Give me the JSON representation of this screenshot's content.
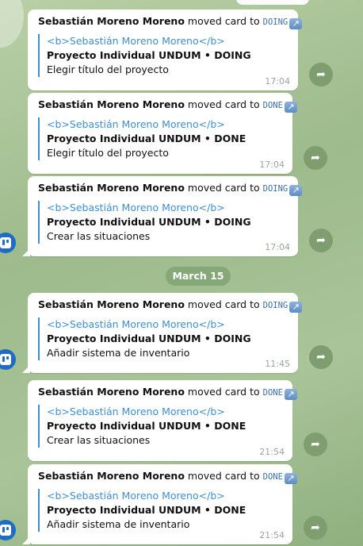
{
  "previous_time": "17:04",
  "date_separator": "March 15",
  "messages": [
    {
      "author": "Sebastián Moreno Moreno",
      "action": "moved card to",
      "status": "DOING",
      "quote_title": "<b>Sebastián Moreno Moreno</b>",
      "project": "Proyecto Individual UNDUM • DOING",
      "task": "Elegir título del proyecto",
      "time": "17:04"
    },
    {
      "author": "Sebastián Moreno Moreno",
      "action": "moved card to",
      "status": "DONE",
      "quote_title": "<b>Sebastián Moreno Moreno</b>",
      "project": "Proyecto Individual UNDUM • DONE",
      "task": "Elegir título del proyecto",
      "time": "17:04"
    },
    {
      "author": "Sebastián Moreno Moreno",
      "action": "moved card to",
      "status": "DOING",
      "quote_title": "<b>Sebastián Moreno Moreno</b>",
      "project": "Proyecto Individual UNDUM • DOING",
      "task": "Crear las situaciones",
      "time": "17:04"
    },
    {
      "author": "Sebastián Moreno Moreno",
      "action": "moved card to",
      "status": "DOING",
      "quote_title": "<b>Sebastián Moreno Moreno</b>",
      "project": "Proyecto Individual UNDUM • DOING",
      "task": "Añadir sistema de inventario",
      "time": "11:45"
    },
    {
      "author": "Sebastián Moreno Moreno",
      "action": "moved card to",
      "status": "DONE",
      "quote_title": "<b>Sebastián Moreno Moreno</b>",
      "project": "Proyecto Individual UNDUM • DONE",
      "task": "Crear las situaciones",
      "time": "21:54"
    },
    {
      "author": "Sebastián Moreno Moreno",
      "action": "moved card to",
      "status": "DONE",
      "quote_title": "<b>Sebastián Moreno Moreno</b>",
      "project": "Proyecto Individual UNDUM • DONE",
      "task": "Añadir sistema de inventario",
      "time": "21:54"
    }
  ],
  "icons": {
    "share": "share-arrow-icon",
    "avatar": "trello-bot-avatar",
    "link": "external-link-icon"
  },
  "colors": {
    "link": "#3f8fcf",
    "accent_pill": "#86a878",
    "avatar": "#1e6cc5",
    "share": "#7e9e70"
  }
}
